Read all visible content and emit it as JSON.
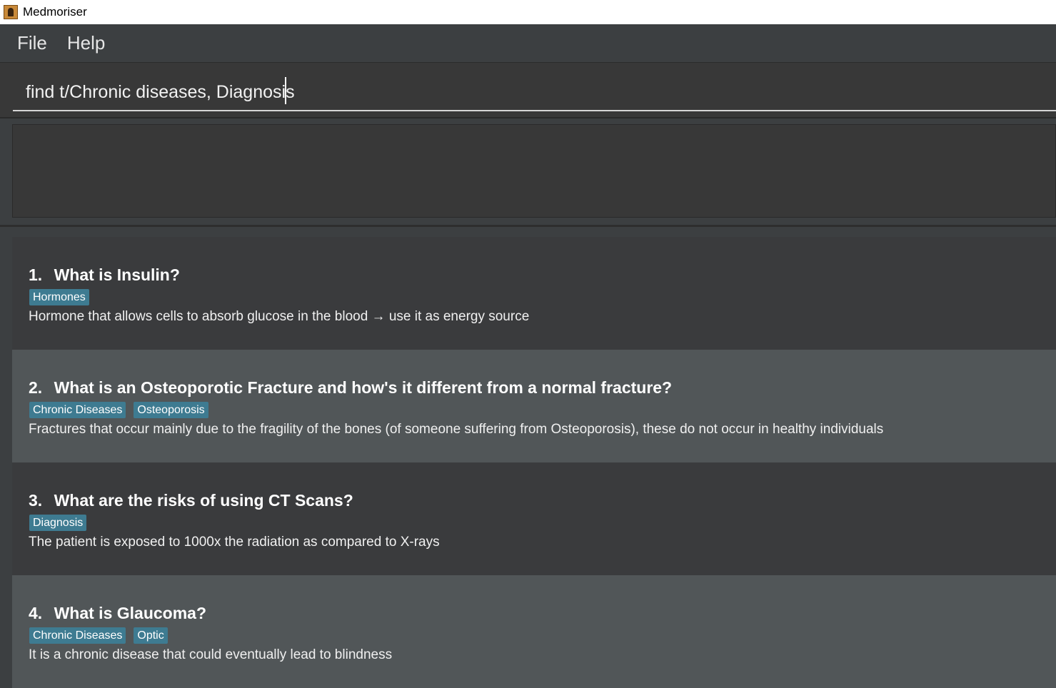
{
  "window": {
    "title": "Medmoriser"
  },
  "menu": {
    "items": [
      "File",
      "Help"
    ]
  },
  "command": {
    "value": "find t/Chronic diseases, Diagnosis"
  },
  "result": {
    "text": ""
  },
  "questions": [
    {
      "number": "1.",
      "question": "What is Insulin?",
      "tags": [
        "Hormones"
      ],
      "answer": "Hormone that allows cells to absorb glucose in the blood → use it as energy source"
    },
    {
      "number": "2.",
      "question": "What is an Osteoporotic Fracture and how's it different from a normal fracture?",
      "tags": [
        "Chronic Diseases",
        "Osteoporosis"
      ],
      "answer": "Fractures that occur mainly due to the fragility of the bones (of someone suffering from Osteoporosis), these do not occur in healthy individuals"
    },
    {
      "number": "3.",
      "question": "What are the risks of using CT Scans?",
      "tags": [
        "Diagnosis"
      ],
      "answer": "The patient is exposed to 1000x the radiation as compared to X-rays"
    },
    {
      "number": "4.",
      "question": "What is Glaucoma?",
      "tags": [
        "Chronic Diseases",
        "Optic"
      ],
      "answer": "It is a chronic disease that could eventually lead to blindness"
    }
  ],
  "colors": {
    "background": "#3c3f41",
    "card_dark": "#3a3b3d",
    "card_light": "#515658",
    "tag": "#3e7b91",
    "text": "#ffffff"
  }
}
